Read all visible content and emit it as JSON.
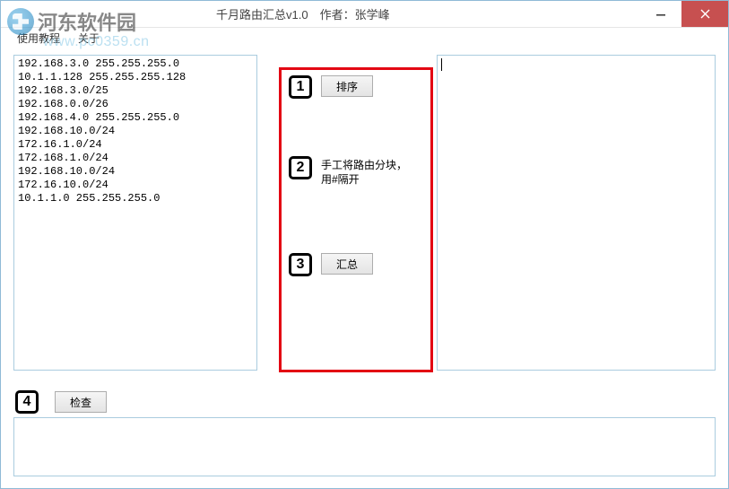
{
  "window": {
    "title": "千月路由汇总v1.0　作者：张学峰"
  },
  "watermark": {
    "title": "河东软件园",
    "url": "www.pc0359.cn"
  },
  "menu": {
    "tutorial": "使用教程",
    "about": "关于"
  },
  "left": {
    "text": "192.168.3.0 255.255.255.0\n10.1.1.128 255.255.255.128\n192.168.3.0/25\n192.168.0.0/26\n192.168.4.0 255.255.255.0\n192.168.10.0/24\n172.16.1.0/24\n172.168.1.0/24\n192.168.10.0/24\n172.16.10.0/24\n10.1.1.0 255.255.255.0"
  },
  "steps": {
    "s1": {
      "num": "1",
      "button": "排序"
    },
    "s2": {
      "num": "2",
      "text": "手工将路由分块，用#隔开"
    },
    "s3": {
      "num": "3",
      "button": "汇总"
    },
    "s4": {
      "num": "4",
      "button": "检查"
    }
  },
  "right": {
    "text": ""
  },
  "bottom": {
    "text": ""
  }
}
